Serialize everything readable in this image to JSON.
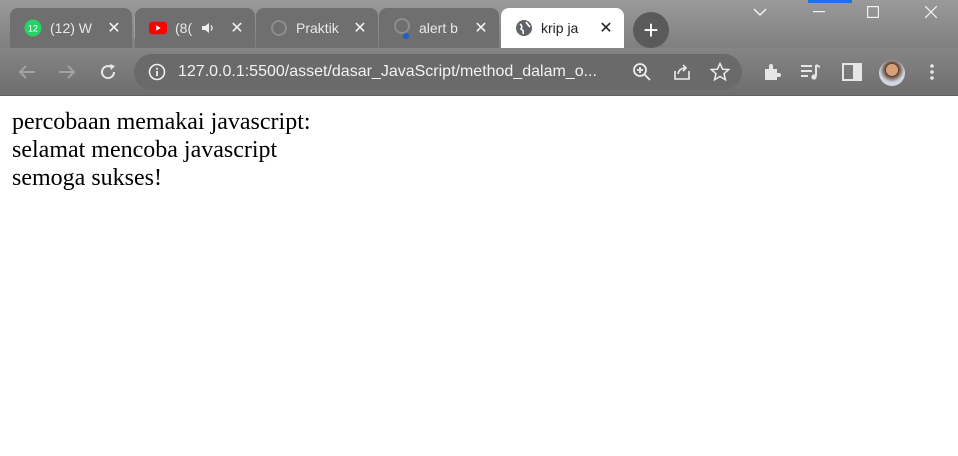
{
  "browser": {
    "tabs": [
      {
        "label": "(12) W",
        "icon": "whatsapp-icon",
        "badge": "12",
        "active": false
      },
      {
        "label": "(8(",
        "icon": "youtube-icon",
        "audio": "speaker-icon",
        "active": false
      },
      {
        "label": "Praktik",
        "icon": "loading-icon",
        "active": false
      },
      {
        "label": "alert b",
        "icon": "loading-icon",
        "active": false
      },
      {
        "label": "krip ja",
        "icon": "globe-icon",
        "active": true
      }
    ],
    "address_bar": {
      "url": "127.0.0.1:5500/asset/dasar_JavaScript/method_dalam_o..."
    },
    "colors": {
      "chrome": "#8a8a8a",
      "active_tab": "#ffffff",
      "accent_whatsapp": "#25d366",
      "accent_youtube": "#ff0000"
    }
  },
  "page": {
    "lines": [
      "percobaan memakai javascript:",
      "selamat mencoba javascript",
      "semoga sukses!"
    ]
  }
}
